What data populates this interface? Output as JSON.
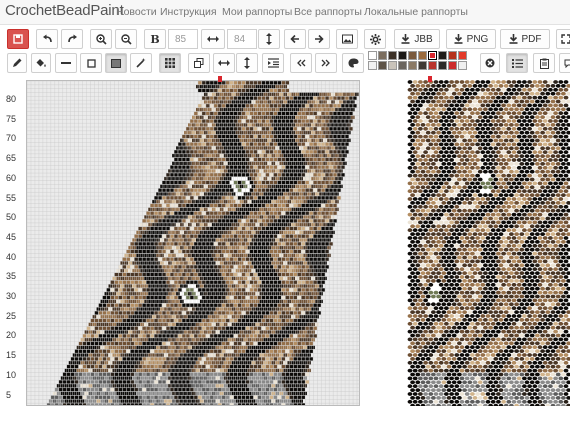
{
  "app": {
    "brand": "CrochetBeadPaint",
    "nav": [
      "Новости",
      "Инструкция",
      "Мои раппорты",
      "Все раппорты",
      "Локальные раппорты"
    ]
  },
  "toolbar1": {
    "bold_label": "B",
    "height_value": "85",
    "width_value": "84",
    "jbb_label": "JBB",
    "png_label": "PNG",
    "pdf_label": "PDF"
  },
  "palette": {
    "colors": [
      "#ffffff",
      "#7b6d5e",
      "#3b3026",
      "#1a1715",
      "#7a5a3d",
      "#9a6a3c",
      "#d9262d",
      "#1f1b18",
      "#b5311b",
      "#e33a2a",
      "#f2f2f2",
      "#5e5448",
      "#c9c3ba",
      "#6a655f",
      "#8b7a66",
      "#3f3a34",
      "#b9342b",
      "#2c2a28",
      "#cc2b2b",
      "#efefef"
    ]
  },
  "ruler": {
    "labels": [
      "80",
      "75",
      "70",
      "65",
      "60",
      "55",
      "50",
      "45",
      "40",
      "35",
      "30",
      "25",
      "20",
      "15",
      "10",
      "5"
    ]
  },
  "pattern": {
    "rows": 85,
    "columns": 84,
    "background": "#ebebeb",
    "grid_line": "#c6c6c6",
    "bead_colors": [
      "#0c0a08",
      "#2a2119",
      "#4a3625",
      "#6e4f33",
      "#95704a",
      "#b48e62",
      "#d1b48c",
      "#ece4d6",
      "#ffffff",
      "#6f7a55",
      "#8e9168",
      "#5d5d5d",
      "#8a8a8a"
    ]
  }
}
